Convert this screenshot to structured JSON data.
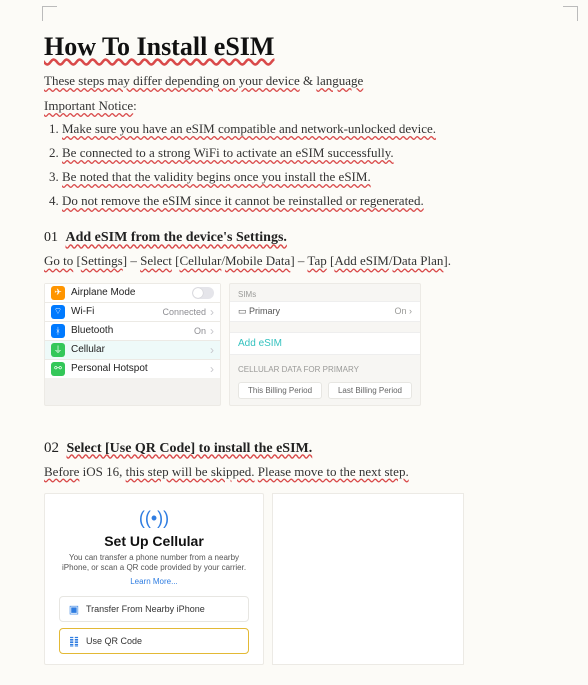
{
  "title": "How To Install eSIM",
  "intro_parts": [
    "These steps may differ depending on your device",
    " & ",
    "language"
  ],
  "important_notice": "Important Notice",
  "notes": [
    "Make sure you have an eSIM compatible and network-unlocked device.",
    "Be connected to a strong WiFi to activate an eSIM successfully.",
    "Be noted that the validity begins once you install the eSIM.",
    "Do not remove the eSIM since it cannot be reinstalled or regenerated."
  ],
  "step1": {
    "num": "01",
    "title": "Add eSIM from the device's Settings.",
    "desc_parts": [
      "Go to",
      " [",
      "Settings",
      "] – ",
      "Select",
      " [",
      "Cellular",
      "/",
      "Mobile Data",
      "] – ",
      "Tap",
      " [",
      "Add eSIM",
      "/",
      "Data Plan",
      "]."
    ]
  },
  "settings_rows": {
    "airplane": "Airplane Mode",
    "wifi": "Wi-Fi",
    "wifi_status": "Connected",
    "bt": "Bluetooth",
    "bt_status": "On",
    "cell": "Cellular",
    "hotspot": "Personal Hotspot"
  },
  "sim_panel": {
    "header": "SIMs",
    "primary": "Primary",
    "primary_status": "On",
    "add": "Add eSIM",
    "data_header": "CELLULAR DATA FOR PRIMARY",
    "tab1": "This Billing Period",
    "tab2": "Last Billing Period"
  },
  "step2": {
    "num": "02",
    "title": "Select [Use QR Code] to install the eSIM.",
    "desc_parts": [
      "Before",
      " iOS 16, ",
      "this step will be skipped.",
      " ",
      "Please move to the next step."
    ]
  },
  "cellular_card": {
    "title": "Set Up Cellular",
    "desc": "You can transfer a phone number from a nearby iPhone, or scan a QR code provided by your carrier.",
    "learn": "Learn More...",
    "opt1": "Transfer From Nearby iPhone",
    "opt2": "Use QR Code"
  }
}
